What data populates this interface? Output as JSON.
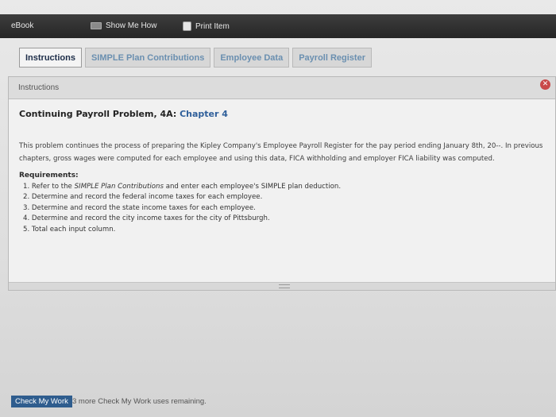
{
  "toolbar": {
    "ebook": "eBook",
    "show_me_how": "Show Me How",
    "print_item": "Print Item"
  },
  "tabs": [
    {
      "label": "Instructions",
      "active": true
    },
    {
      "label": "SIMPLE Plan Contributions",
      "active": false
    },
    {
      "label": "Employee Data",
      "active": false
    },
    {
      "label": "Payroll Register",
      "active": false
    }
  ],
  "panel": {
    "title": "Instructions",
    "problem_title": "Continuing Payroll Problem, 4A:",
    "chapter": "Chapter 4",
    "description": "This problem continues the process of preparing the Kipley Company's Employee Payroll Register for the pay period ending January 8th, 20--. In previous chapters, gross wages were computed for each employee and using this data, FICA withholding and employer FICA liability was computed.",
    "requirements_heading": "Requirements:",
    "requirements": [
      {
        "pre": "1. Refer to the ",
        "em": "SIMPLE Plan Contributions",
        "post": " and enter each employee's SIMPLE plan deduction."
      },
      {
        "pre": "2. Determine and record the federal income taxes for each employee.",
        "em": "",
        "post": ""
      },
      {
        "pre": "3. Determine and record the state income taxes for each employee.",
        "em": "",
        "post": ""
      },
      {
        "pre": "4. Determine and record the city income taxes for the city of Pittsburgh.",
        "em": "",
        "post": ""
      },
      {
        "pre": "5. Total each input column.",
        "em": "",
        "post": ""
      }
    ]
  },
  "footer": {
    "check_button": "Check My Work",
    "remaining": "3 more Check My Work uses remaining."
  },
  "icons": {
    "close": "close-icon",
    "book": "book-icon",
    "print": "print-icon"
  },
  "colors": {
    "toolbar_bg": "#2e2e2e",
    "link_blue": "#2f5f9a",
    "check_button": "#2f5d8e",
    "close_red": "#c94a4a"
  }
}
